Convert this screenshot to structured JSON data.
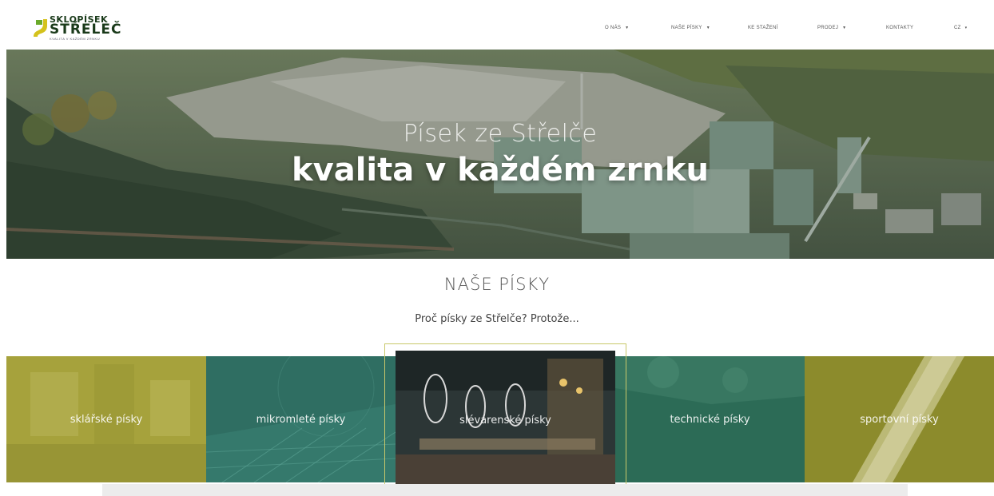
{
  "header": {
    "logo_top": "SKLOPÍSEK",
    "logo_main": "STŘELEČ",
    "logo_tag": "KVALITA V KAŽDÉM ZRNKU"
  },
  "nav": [
    {
      "label": "O NÁS",
      "dropdown": true
    },
    {
      "label": "NAŠE PÍSKY",
      "dropdown": true
    },
    {
      "label": "KE STAŽENÍ",
      "dropdown": false
    },
    {
      "label": "PRODEJ",
      "dropdown": true
    },
    {
      "label": "KONTAKTY",
      "dropdown": false
    },
    {
      "label": "CZ",
      "dropdown": true
    }
  ],
  "hero": {
    "subtitle": "Písek ze Střelče",
    "title": "kvalita v každém zrnku"
  },
  "section": {
    "title": "NAŠE PÍSKY",
    "subtitle": "Proč písky ze Střelče? Protože..."
  },
  "tiles": [
    {
      "label": "sklářské písky",
      "color": "#a6a23c"
    },
    {
      "label": "mikromleté písky",
      "color": "#2f6e62"
    },
    {
      "label": "slévárenské písky",
      "color": "#2c3636"
    },
    {
      "label": "technické písky",
      "color": "#2c6b56"
    },
    {
      "label": "sportovní písky",
      "color": "#8c8b2c"
    }
  ],
  "colors": {
    "accent_olive": "#a6a23c",
    "accent_teal": "#2f6e62",
    "logo_green": "#6aaa2a",
    "logo_yellow": "#d4c21c"
  }
}
